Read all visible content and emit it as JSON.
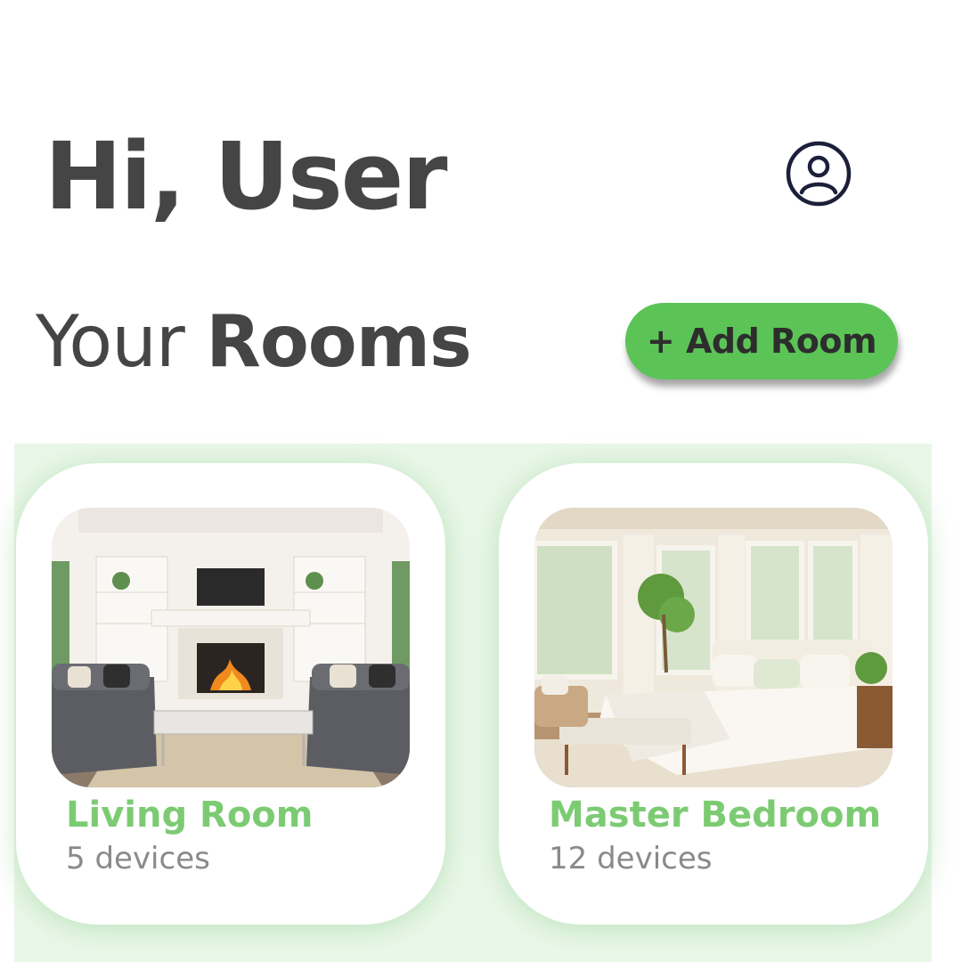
{
  "header": {
    "greeting": "Hi, User",
    "profile_icon": "user-circle-icon"
  },
  "section": {
    "title_light": "Your",
    "title_bold": "Rooms",
    "add_button_label": "+ Add Room"
  },
  "rooms": [
    {
      "name": "Living Room",
      "devices": "5 devices",
      "image": "living-room-photo"
    },
    {
      "name": "Master Bedroom",
      "devices": "12 devices",
      "image": "bedroom-photo"
    }
  ],
  "colors": {
    "accent_green": "#5cc457",
    "room_name_green": "#7ccb73",
    "heading_gray": "#454545",
    "subtext_gray": "#8a8a8a",
    "icon_navy": "#1c1f3a"
  }
}
